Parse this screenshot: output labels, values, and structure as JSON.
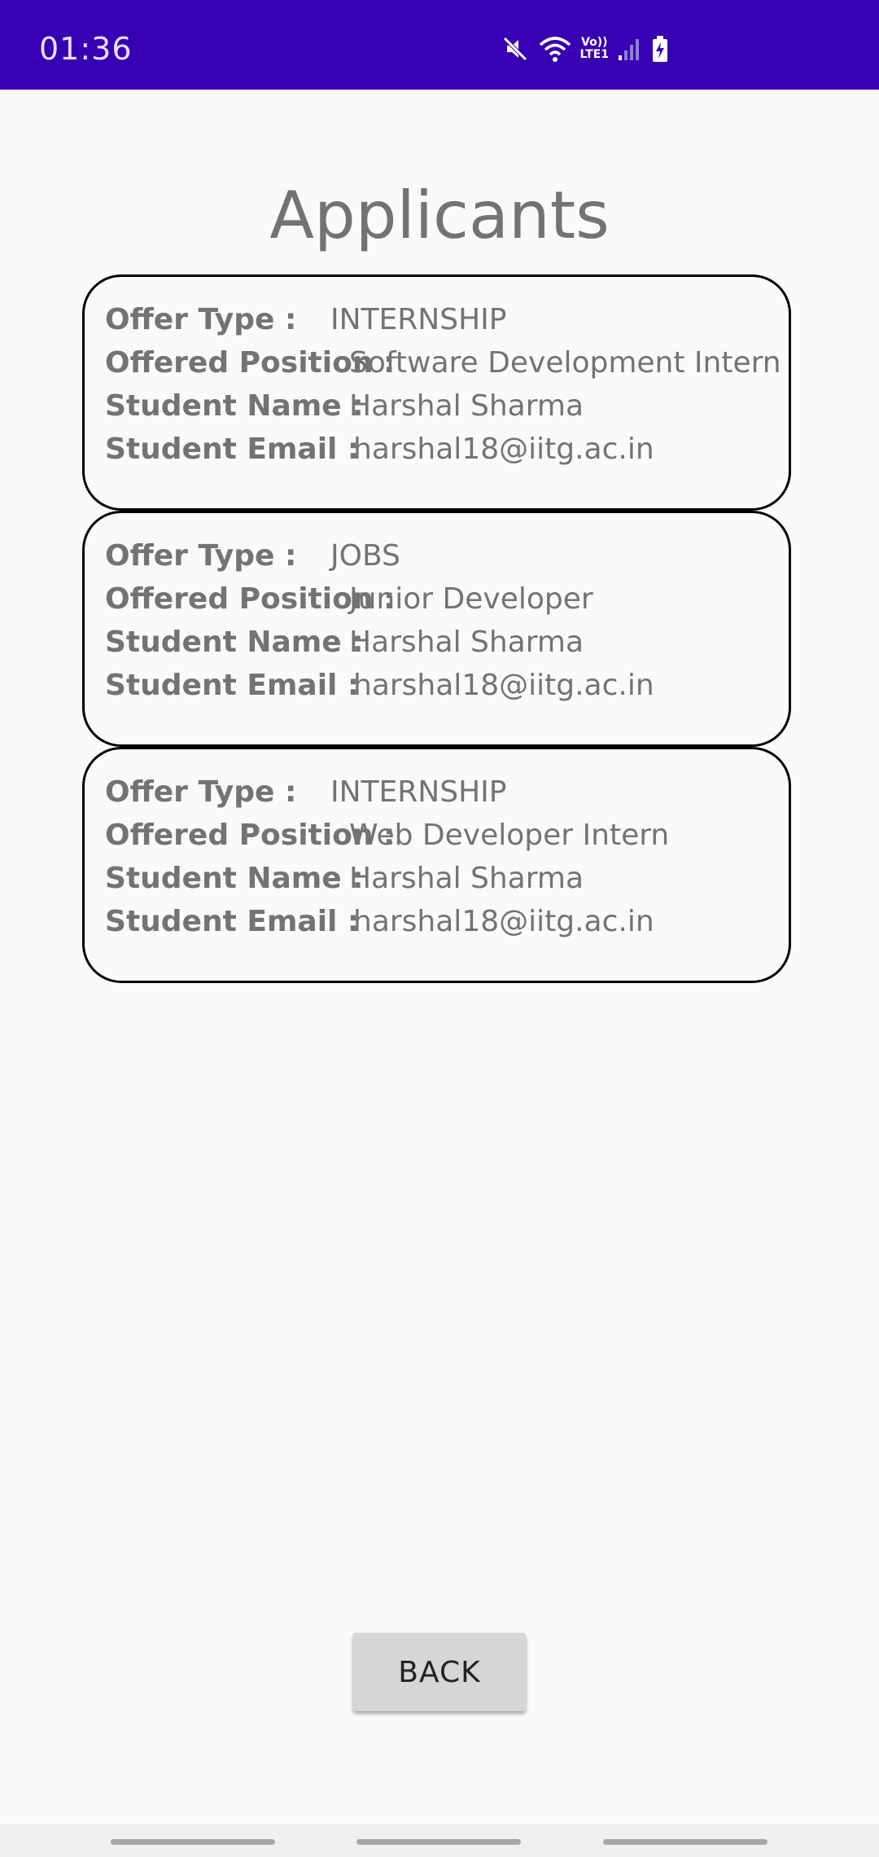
{
  "status_bar": {
    "time": "01:36",
    "icons": [
      "mute-icon",
      "wifi-icon",
      "volte-icon",
      "signal-icon",
      "battery-charging-icon"
    ],
    "volte_top": "Vo))",
    "volte_bottom": "LTE1",
    "background": "#3700b3"
  },
  "page": {
    "title": "Applicants"
  },
  "labels": {
    "offer_type": "Offer Type :",
    "offered_position": "Offered Position :",
    "student_name": "Student Name :",
    "student_email": "Student Email :"
  },
  "applicants": [
    {
      "offer_type": "INTERNSHIP",
      "offered_position": "Software Development Intern",
      "student_name": "Harshal Sharma",
      "student_email": "harshal18@iitg.ac.in"
    },
    {
      "offer_type": "JOBS",
      "offered_position": "Junior Developer",
      "student_name": "Harshal Sharma",
      "student_email": "harshal18@iitg.ac.in"
    },
    {
      "offer_type": "INTERNSHIP",
      "offered_position": "Web Developer Intern",
      "student_name": "Harshal Sharma",
      "student_email": "harshal18@iitg.ac.in"
    }
  ],
  "actions": {
    "back_label": "BACK"
  }
}
